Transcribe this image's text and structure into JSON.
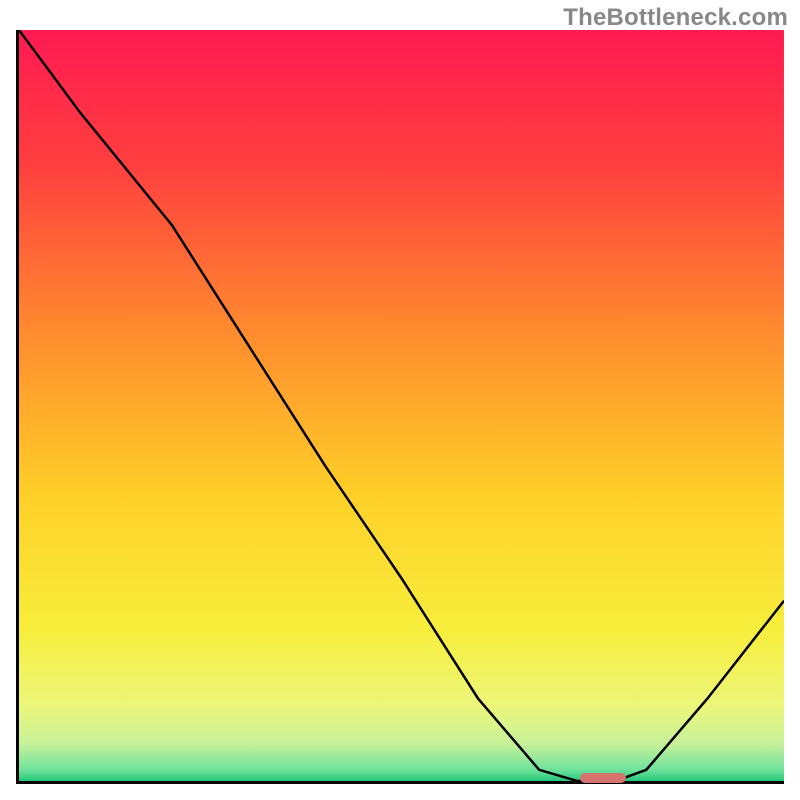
{
  "watermark": "TheBottleneck.com",
  "chart_data": {
    "type": "line",
    "title": "",
    "xlabel": "",
    "ylabel": "",
    "x": [
      0.0,
      0.08,
      0.2,
      0.3,
      0.4,
      0.5,
      0.6,
      0.68,
      0.73,
      0.78,
      0.82,
      0.9,
      1.0
    ],
    "values": [
      1.0,
      0.89,
      0.74,
      0.58,
      0.42,
      0.27,
      0.11,
      0.015,
      0.0,
      0.0,
      0.015,
      0.11,
      0.24
    ],
    "xlim": [
      0,
      1
    ],
    "ylim": [
      0,
      1
    ],
    "gradient_stops": [
      {
        "offset": 0.0,
        "color": "#ff1a52"
      },
      {
        "offset": 0.18,
        "color": "#ff3f3f"
      },
      {
        "offset": 0.4,
        "color": "#ff8a2e"
      },
      {
        "offset": 0.62,
        "color": "#ffd028"
      },
      {
        "offset": 0.8,
        "color": "#f7ee3c"
      },
      {
        "offset": 0.9,
        "color": "#ecf67a"
      },
      {
        "offset": 0.95,
        "color": "#c8f29a"
      },
      {
        "offset": 0.985,
        "color": "#6fe29c"
      },
      {
        "offset": 1.0,
        "color": "#22c87a"
      }
    ],
    "marker": {
      "x_start": 0.73,
      "x_end": 0.79,
      "y": 0.0,
      "color": "#d6736e"
    }
  }
}
